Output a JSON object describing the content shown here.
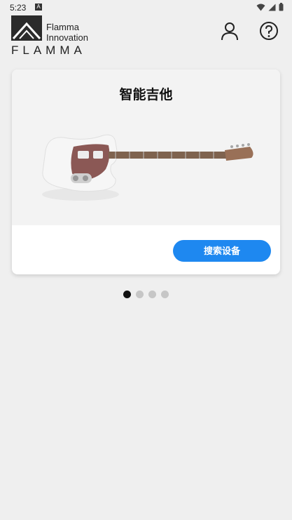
{
  "status_bar": {
    "time": "5:23",
    "badge": "A"
  },
  "header": {
    "brand_line1": "Flamma",
    "brand_line2": "Innovation",
    "brand_wordmark": "FLAMMA",
    "user_icon": "user-icon",
    "help_icon": "help-icon"
  },
  "card": {
    "title": "智能吉他",
    "image": "electric-guitar",
    "search_button": "搜索设备"
  },
  "pager": {
    "count": 4,
    "active_index": 0
  },
  "colors": {
    "accent": "#1e88f0",
    "background": "#efefef"
  }
}
